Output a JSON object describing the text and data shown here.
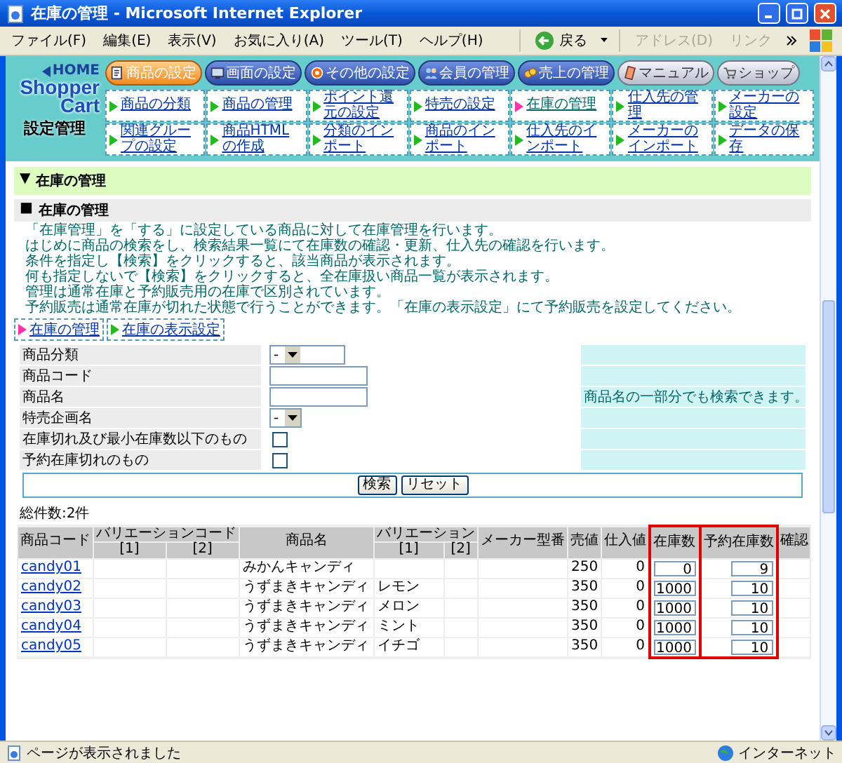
{
  "window": {
    "title": "在庫の管理 - Microsoft Internet Explorer"
  },
  "menu": [
    "ファイル(F)",
    "編集(E)",
    "表示(V)",
    "お気に入り(A)",
    "ツール(T)",
    "ヘルプ(H)"
  ],
  "toolbar": {
    "back": "戻る",
    "address": {
      "label": "アドレス(D)",
      "disabled": true
    },
    "links": {
      "label": "リンク",
      "disabled": true
    }
  },
  "header": {
    "home": "HOME",
    "logo": [
      "Shopper",
      "Cart"
    ],
    "logo_caption": "設定管理",
    "tabs": [
      {
        "label": "商品の設定",
        "selected": true,
        "kind": "main"
      },
      {
        "label": "画面の設定",
        "selected": false,
        "kind": "main"
      },
      {
        "label": "その他の設定",
        "selected": false,
        "kind": "main"
      },
      {
        "label": "会員の管理",
        "selected": false,
        "kind": "main"
      },
      {
        "label": "売上の管理",
        "selected": false,
        "kind": "main"
      },
      {
        "label": "マニュアル",
        "selected": false,
        "kind": "extra"
      },
      {
        "label": "ショップ",
        "selected": false,
        "kind": "extra"
      }
    ],
    "links": [
      {
        "label": "商品の分類",
        "selected": false
      },
      {
        "label": "商品の管理",
        "selected": false
      },
      {
        "label": "ポイント還元の設定",
        "selected": false
      },
      {
        "label": "特売の設定",
        "selected": false
      },
      {
        "label": "在庫の管理",
        "selected": true
      },
      {
        "label": "仕入先の管理",
        "selected": false
      },
      {
        "label": "メーカーの設定",
        "selected": false
      },
      {
        "label": "関連グループの設定",
        "selected": false
      },
      {
        "label": "商品HTMLの作成",
        "selected": false
      },
      {
        "label": "分類のインポート",
        "selected": false
      },
      {
        "label": "商品のインポート",
        "selected": false
      },
      {
        "label": "仕入先のインポート",
        "selected": false
      },
      {
        "label": "メーカーのインポート",
        "selected": false
      },
      {
        "label": "データの保存",
        "selected": false
      }
    ]
  },
  "section": {
    "marker": "▼",
    "title": "在庫の管理"
  },
  "subsection": {
    "marker": "■",
    "title": "在庫の管理"
  },
  "description": [
    "「在庫管理」を「する」に設定している商品に対して在庫管理を行います。",
    "はじめに商品の検索をし、検索結果一覧にて在庫数の確認・更新、仕入先の確認を行います。",
    "条件を指定し【検索】をクリックすると、該当商品が表示されます。",
    "何も指定しないで【検索】をクリックすると、全在庫扱い商品一覧が表示されます。",
    "管理は通常在庫と予約販売用の在庫で区別されています。",
    "予約販売は通常在庫が切れた状態で行うことができます。「在庫の表示設定」にて予約販売を設定してください。"
  ],
  "sublinks": [
    {
      "label": "在庫の管理",
      "selected": true
    },
    {
      "label": "在庫の表示設定",
      "selected": false
    }
  ],
  "form": [
    {
      "label": "商品分類",
      "kind": "select",
      "value": "-"
    },
    {
      "label": "商品コード",
      "kind": "text"
    },
    {
      "label": "商品名",
      "kind": "text",
      "hint": "商品名の一部分でも検索できます。"
    },
    {
      "label": "特売企画名",
      "kind": "select",
      "value": "-"
    },
    {
      "label": "在庫切れ及び最小在庫数以下のもの",
      "kind": "checkbox",
      "checked": false
    },
    {
      "label": "予約在庫切れのもの",
      "kind": "checkbox",
      "checked": false
    }
  ],
  "buttons": [
    "検索",
    "リセット"
  ],
  "table": {
    "count": "総件数:2件",
    "columns": [
      {
        "label": "商品コード"
      },
      {
        "label": "バリエーションコード",
        "subcolumns": [
          "[1]",
          "[2]"
        ]
      },
      {
        "label": "商品名"
      },
      {
        "label": "バリエーション",
        "subcolumns": [
          "[1]",
          "[2]"
        ]
      },
      {
        "label": "メーカー型番"
      },
      {
        "label": "売値"
      },
      {
        "label": "仕入値"
      },
      {
        "label": "在庫数",
        "highlighted": true
      },
      {
        "label": "予約在庫数",
        "highlighted": true
      },
      {
        "label": "確認"
      }
    ],
    "rows": [
      {
        "code": "candy01",
        "name": "みかんキャンディ",
        "price": "250",
        "cost": "0",
        "stock": "0",
        "reserved": "9"
      },
      {
        "code": "candy02",
        "name": "うずまきキャンディ",
        "variation_1": "レモン",
        "price": "350",
        "cost": "0",
        "stock": "1000",
        "reserved": "10"
      },
      {
        "code": "candy03",
        "name": "うずまきキャンディ",
        "variation_1": "メロン",
        "price": "350",
        "cost": "0",
        "stock": "1000",
        "reserved": "10"
      },
      {
        "code": "candy04",
        "name": "うずまきキャンディ",
        "variation_1": "ミント",
        "price": "350",
        "cost": "0",
        "stock": "1000",
        "reserved": "10"
      },
      {
        "code": "candy05",
        "name": "うずまきキャンディ",
        "variation_1": "イチゴ",
        "price": "350",
        "cost": "0",
        "stock": "1000",
        "reserved": "10"
      }
    ]
  },
  "status_bar": {
    "text": "ページが表示されました",
    "zone": "インターネット"
  }
}
